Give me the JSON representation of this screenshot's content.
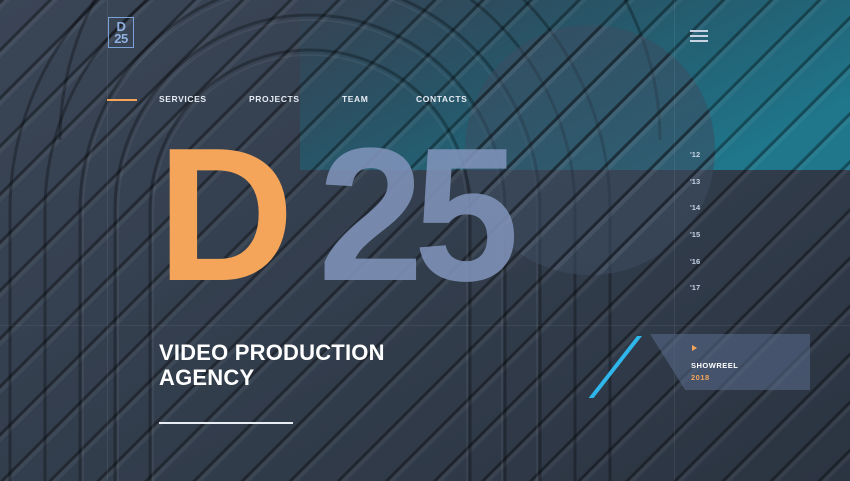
{
  "brand": {
    "logo_top": "D",
    "logo_bottom": "25"
  },
  "nav": {
    "items": [
      {
        "label": "SERVICES"
      },
      {
        "label": "PROJECTS"
      },
      {
        "label": "TEAM"
      },
      {
        "label": "CONTACTS"
      }
    ]
  },
  "hero": {
    "big_letter": "D",
    "big_number": "25",
    "headline_line1": "VIDEO PRODUCTION",
    "headline_line2": "AGENCY"
  },
  "years": [
    "'12",
    "'13",
    "'14",
    "'15",
    "'16",
    "'17"
  ],
  "showreel": {
    "label": "SHOWREEL",
    "year": "2018"
  },
  "colors": {
    "accent": "#f5a55a",
    "secondary": "#8093ba",
    "stripe": "#2fb6ea",
    "background": "#34404f"
  },
  "icons": {
    "menu": "hamburger-menu-icon",
    "play": "play-icon"
  }
}
